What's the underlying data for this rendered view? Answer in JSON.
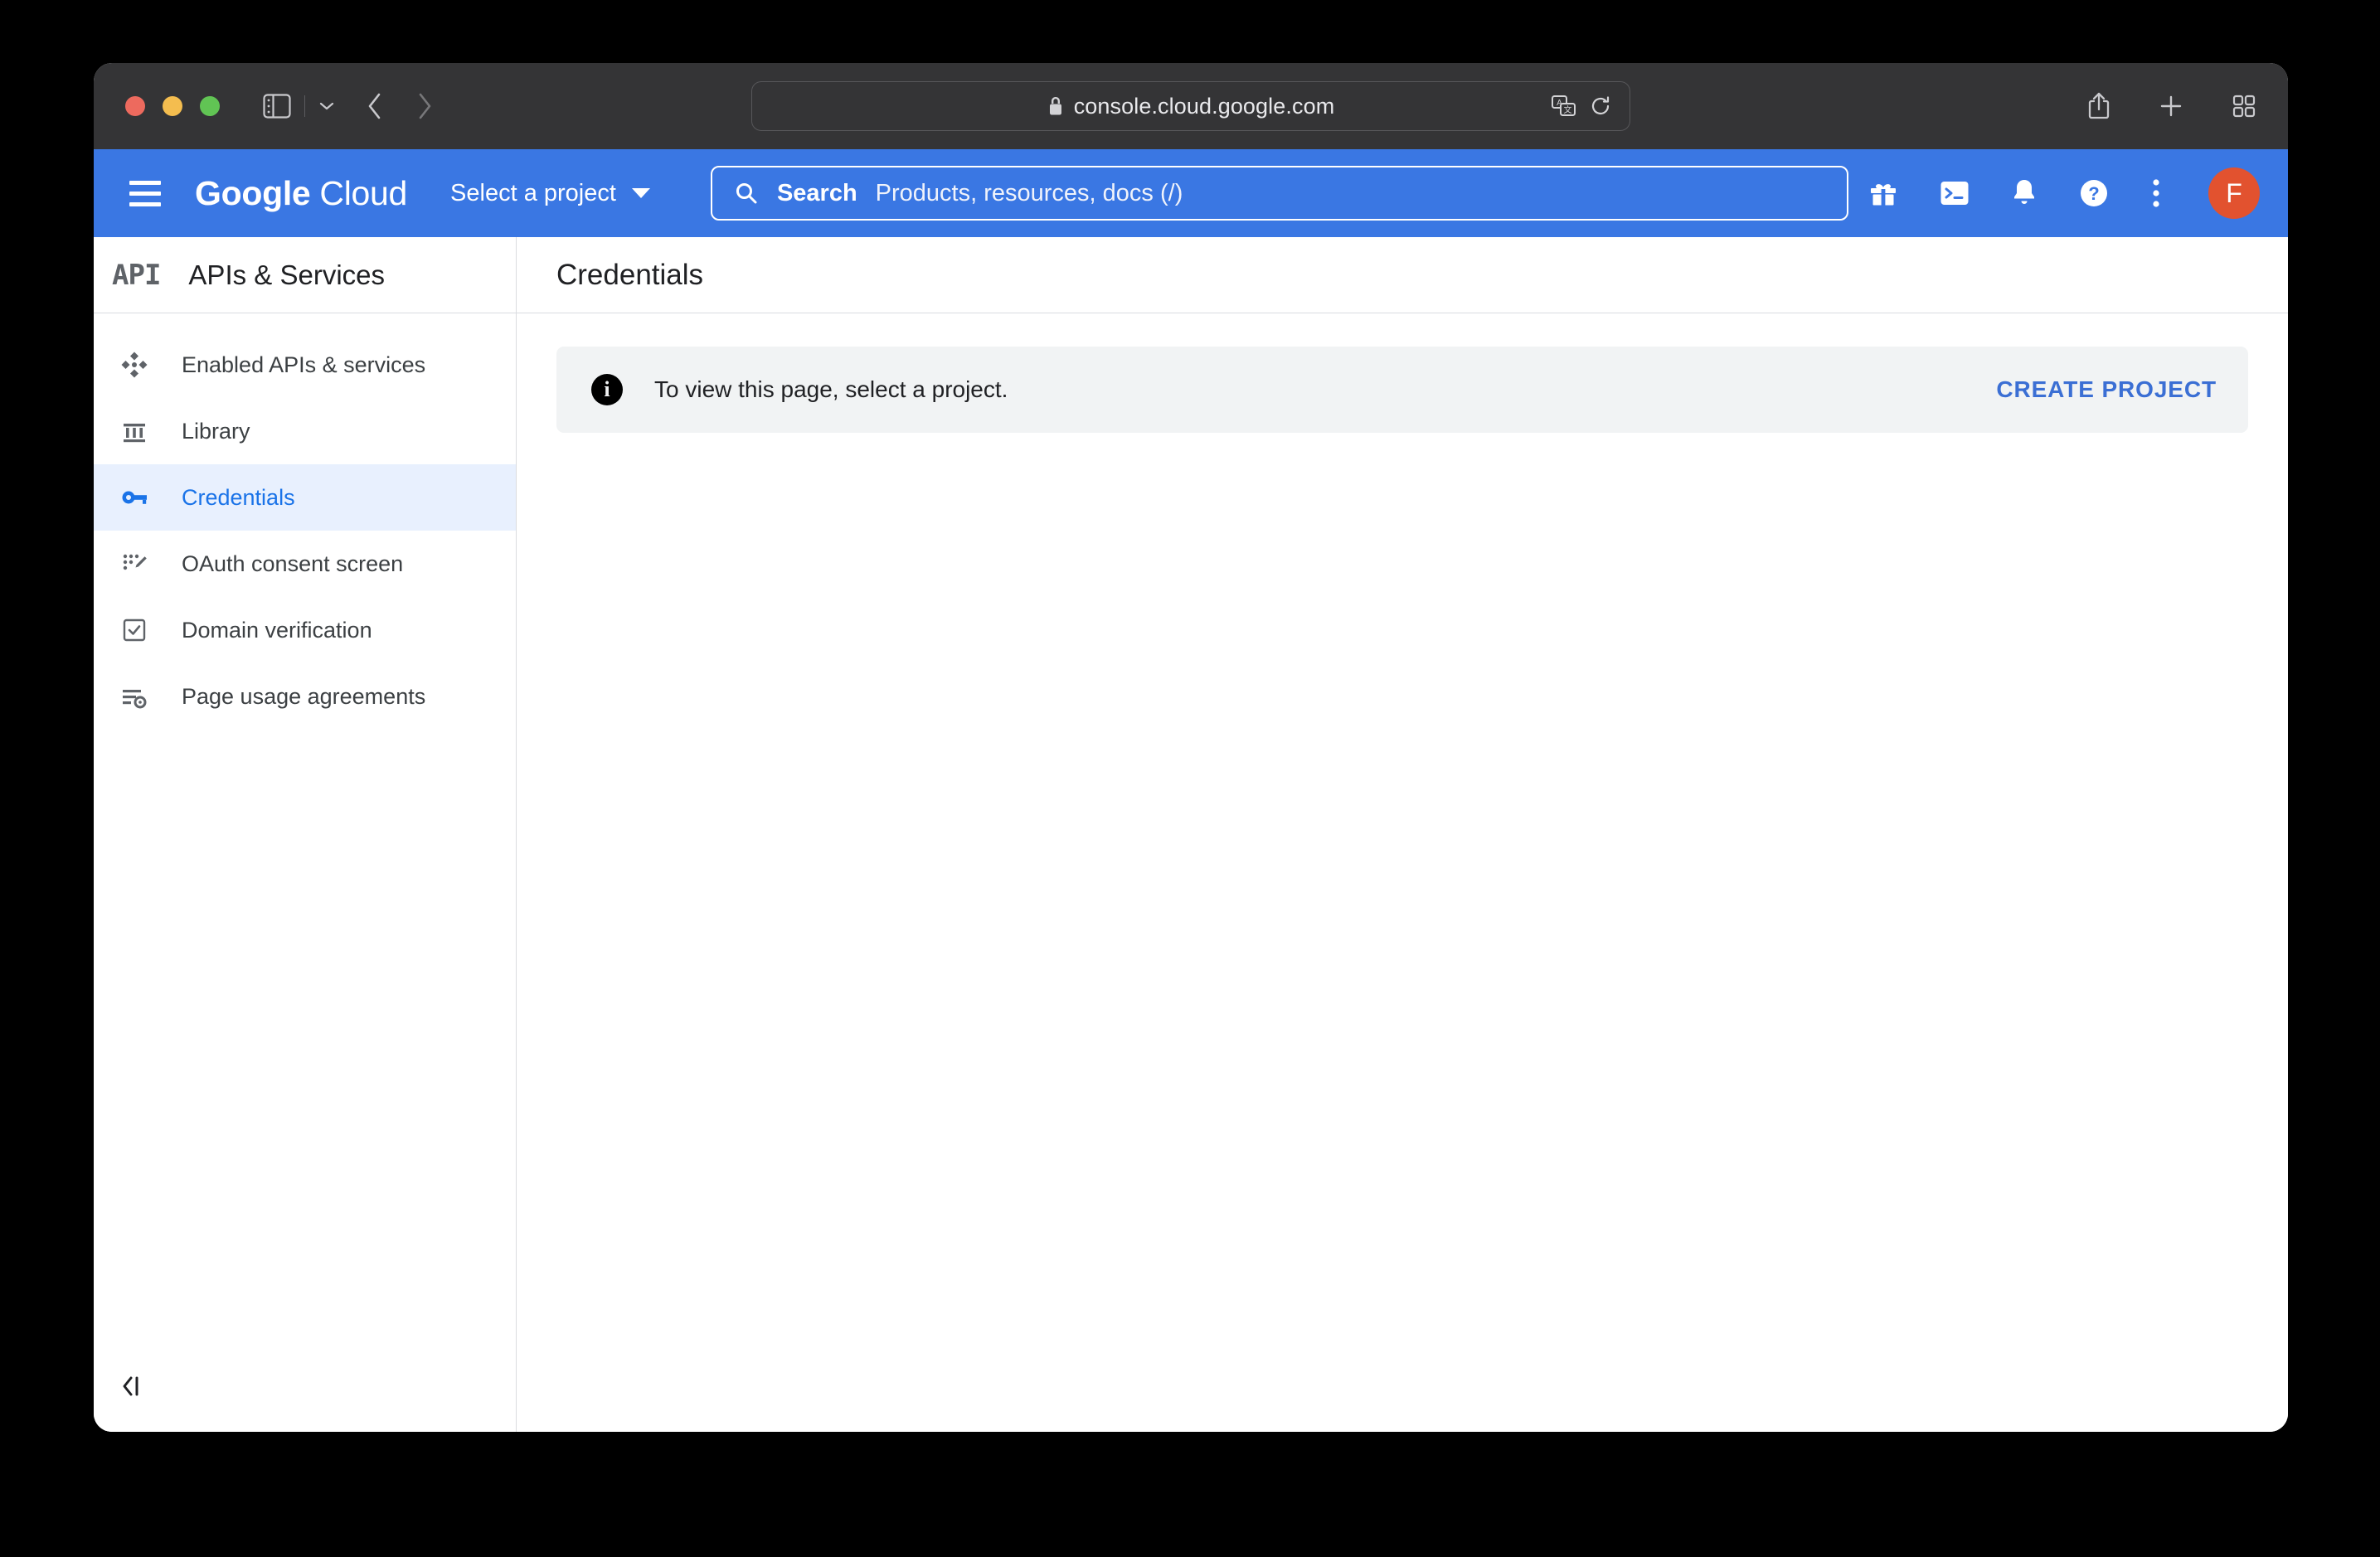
{
  "browser": {
    "url": "console.cloud.google.com",
    "icons": {
      "lock": "lock-icon",
      "translate": "translate-icon",
      "reload": "reload-icon",
      "sidebar_toggle": "sidebar-toggle-icon",
      "tab_group_chevron": "chevron-down-icon",
      "back": "back-arrow-icon",
      "forward": "forward-arrow-icon",
      "share": "share-icon",
      "new_tab": "plus-icon",
      "tab_overview": "tab-overview-icon"
    },
    "traffic_lights": [
      "close-button",
      "minimize-button",
      "zoom-button"
    ]
  },
  "header": {
    "menu_label": "Main menu",
    "brand_bold": "Google",
    "brand_light": "Cloud",
    "project_selector": "Select a project",
    "search": {
      "label": "Search",
      "placeholder": "Products, resources, docs (/)"
    },
    "actions": [
      {
        "name": "gift-icon",
        "label": "Offers"
      },
      {
        "name": "cloud-shell-icon",
        "label": "Activate Cloud Shell"
      },
      {
        "name": "bell-icon",
        "label": "Notifications"
      },
      {
        "name": "help-icon",
        "label": "Support"
      },
      {
        "name": "more-vert-icon",
        "label": "More options"
      }
    ],
    "avatar_initial": "F",
    "colors": {
      "header_blue": "#3a77e3",
      "avatar_orange": "#e2522f"
    }
  },
  "sidebar": {
    "logo": "API",
    "title": "APIs & Services",
    "items": [
      {
        "label": "Enabled APIs & services",
        "icon": "enabled-apis-icon",
        "active": false
      },
      {
        "label": "Library",
        "icon": "library-icon",
        "active": false
      },
      {
        "label": "Credentials",
        "icon": "key-icon",
        "active": true
      },
      {
        "label": "OAuth consent screen",
        "icon": "oauth-consent-icon",
        "active": false
      },
      {
        "label": "Domain verification",
        "icon": "domain-verification-icon",
        "active": false
      },
      {
        "label": "Page usage agreements",
        "icon": "page-usage-agreements-icon",
        "active": false
      }
    ],
    "collapse_label": "Hide navigation menu",
    "active_color": "#1a73e8",
    "active_bg": "#e8f0fe"
  },
  "main": {
    "page_title": "Credentials",
    "banner": {
      "icon": "info-icon",
      "message": "To view this page, select a project.",
      "action_label": "CREATE PROJECT",
      "action_color": "#3b6fd4",
      "background": "#f1f3f4"
    }
  },
  "annotation": {
    "type": "arrow-up",
    "target": "CREATE PROJECT",
    "color": "#e5402b"
  }
}
